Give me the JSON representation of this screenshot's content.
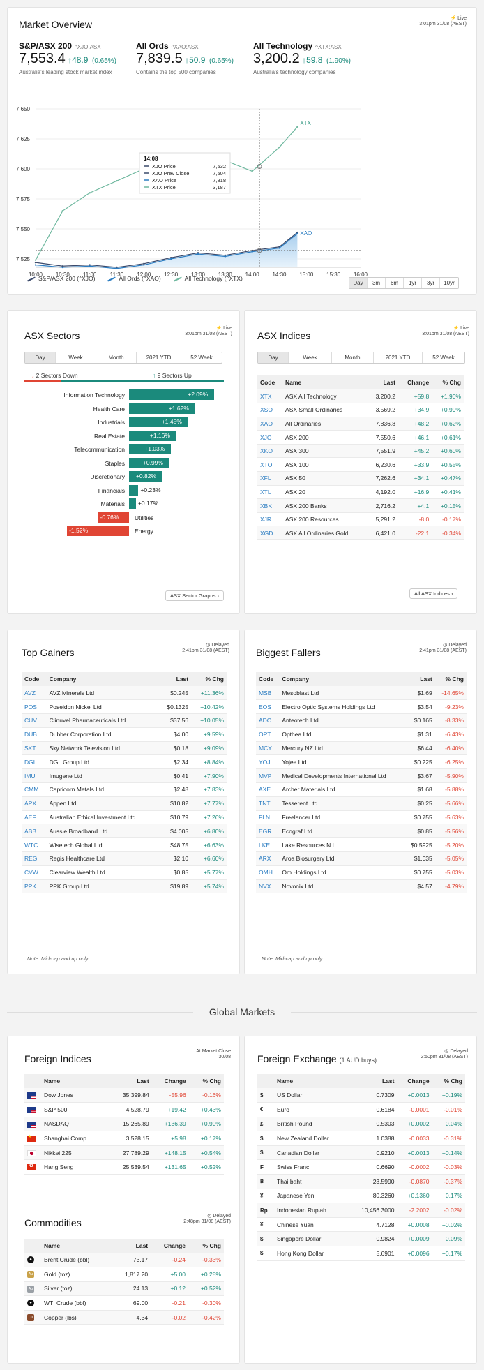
{
  "overview": {
    "title": "Market Overview",
    "live": "Live",
    "time": "3:01pm 31/08 (AEST)",
    "indices": [
      {
        "name": "S&P/ASX 200",
        "code": "^XJO:ASX",
        "value": "7,553.4",
        "change": "48.9",
        "pct": "(0.65%)",
        "desc": "Australia's leading stock market index"
      },
      {
        "name": "All Ords",
        "code": "^XAO:ASX",
        "value": "7,839.5",
        "change": "50.9",
        "pct": "(0.65%)",
        "desc": "Contains the top 500 companies"
      },
      {
        "name": "All Technology",
        "code": "^XTX:ASX",
        "value": "3,200.2",
        "change": "59.8",
        "pct": "(1.90%)",
        "desc": "Australia's technology companies"
      }
    ]
  },
  "chart_data": {
    "type": "line",
    "y_ticks": [
      "7,650",
      "7,625",
      "7,600",
      "7,575",
      "7,550",
      "7,525"
    ],
    "x_ticks": [
      "10:00",
      "10:30",
      "11:00",
      "11:30",
      "12:00",
      "12:30",
      "13:00",
      "13:30",
      "14:00",
      "14:30",
      "15:00",
      "15:30",
      "16:00"
    ],
    "series": [
      {
        "name": "S&P/ASX 200 (^XJO)",
        "color": "#3b4a6b",
        "x": [
          "10:00",
          "10:30",
          "11:00",
          "11:30",
          "12:00",
          "12:30",
          "13:00",
          "13:30",
          "14:00",
          "14:30",
          "14:50"
        ],
        "values": [
          7522,
          7519,
          7520,
          7518,
          7521,
          7526,
          7530,
          7528,
          7532,
          7535,
          7547
        ]
      },
      {
        "name": "All Ords (^XAO)",
        "color": "#2a7cc1",
        "x": [
          "10:00",
          "10:30",
          "11:00",
          "11:30",
          "12:00",
          "12:30",
          "13:00",
          "13:30",
          "14:00",
          "14:30",
          "14:50"
        ],
        "values": [
          7520,
          7518,
          7519,
          7517,
          7520,
          7525,
          7529,
          7527,
          7531,
          7534,
          7546
        ]
      },
      {
        "name": "All Technology (^XTX)",
        "color": "#6fb89f",
        "x": [
          "10:00",
          "10:30",
          "11:00",
          "11:30",
          "12:00",
          "12:30",
          "13:00",
          "13:30",
          "14:00",
          "14:30",
          "14:50"
        ],
        "values": [
          7524,
          7565,
          7580,
          7590,
          7600,
          7606,
          7612,
          7607,
          7598,
          7618,
          7635
        ]
      }
    ],
    "end_labels": [
      "XTX",
      "XAO"
    ],
    "tooltip": {
      "time": "14:08",
      "rows": [
        [
          "XJO Price",
          "7,532"
        ],
        [
          "XJO Prev Close",
          "7,504"
        ],
        [
          "XAO Price",
          "7,818"
        ],
        [
          "XTX Price",
          "3,187"
        ]
      ]
    },
    "ranges": [
      "Day",
      "3m",
      "6m",
      "1yr",
      "3yr",
      "10yr"
    ],
    "active_range": "Day"
  },
  "sectors": {
    "title": "ASX Sectors",
    "live": "Live",
    "time": "3:01pm 31/08 (AEST)",
    "tabs": [
      "Day",
      "Week",
      "Month",
      "2021 YTD",
      "52 Week"
    ],
    "down_label": "Sectors Down",
    "down_count": "2",
    "up_label": "Sectors Up",
    "up_count": "9",
    "items": [
      {
        "name": "Information Technology",
        "value": "+2.09%",
        "pct": 2.09
      },
      {
        "name": "Health Care",
        "value": "+1.62%",
        "pct": 1.62
      },
      {
        "name": "Industrials",
        "value": "+1.45%",
        "pct": 1.45
      },
      {
        "name": "Real Estate",
        "value": "+1.16%",
        "pct": 1.16
      },
      {
        "name": "Telecommunication",
        "value": "+1.03%",
        "pct": 1.03
      },
      {
        "name": "Staples",
        "value": "+0.99%",
        "pct": 0.99
      },
      {
        "name": "Discretionary",
        "value": "+0.82%",
        "pct": 0.82
      },
      {
        "name": "Financials",
        "value": "+0.23%",
        "pct": 0.23
      },
      {
        "name": "Materials",
        "value": "+0.17%",
        "pct": 0.17
      },
      {
        "name": "Utilities",
        "value": "-0.76%",
        "pct": -0.76
      },
      {
        "name": "Energy",
        "value": "-1.52%",
        "pct": -1.52
      }
    ],
    "button": "ASX Sector Graphs"
  },
  "asx_indices": {
    "title": "ASX Indices",
    "live": "Live",
    "time": "3:01pm 31/08 (AEST)",
    "tabs": [
      "Day",
      "Week",
      "Month",
      "2021 YTD",
      "52 Week"
    ],
    "headers": [
      "Code",
      "Name",
      "Last",
      "Change",
      "% Chg"
    ],
    "rows": [
      [
        "XTX",
        "ASX All Technology",
        "3,200.2",
        "+59.8",
        "+1.90%"
      ],
      [
        "XSO",
        "ASX Small Ordinaries",
        "3,569.2",
        "+34.9",
        "+0.99%"
      ],
      [
        "XAO",
        "All Ordinaries",
        "7,836.8",
        "+48.2",
        "+0.62%"
      ],
      [
        "XJO",
        "ASX 200",
        "7,550.6",
        "+46.1",
        "+0.61%"
      ],
      [
        "XKO",
        "ASX 300",
        "7,551.9",
        "+45.2",
        "+0.60%"
      ],
      [
        "XTO",
        "ASX 100",
        "6,230.6",
        "+33.9",
        "+0.55%"
      ],
      [
        "XFL",
        "ASX 50",
        "7,262.6",
        "+34.1",
        "+0.47%"
      ],
      [
        "XTL",
        "ASX 20",
        "4,192.0",
        "+16.9",
        "+0.41%"
      ],
      [
        "XBK",
        "ASX 200 Banks",
        "2,716.2",
        "+4.1",
        "+0.15%"
      ],
      [
        "XJR",
        "ASX 200 Resources",
        "5,291.2",
        "-8.0",
        "-0.17%"
      ],
      [
        "XGD",
        "ASX All Ordinaries Gold",
        "6,421.0",
        "-22.1",
        "-0.34%"
      ]
    ],
    "button": "All ASX Indices"
  },
  "gainers": {
    "title": "Top Gainers",
    "live": "Delayed",
    "time": "2:41pm 31/08 (AEST)",
    "headers": [
      "Code",
      "Company",
      "Last",
      "% Chg"
    ],
    "rows": [
      [
        "AVZ",
        "AVZ Minerals Ltd",
        "$0.245",
        "+11.36%"
      ],
      [
        "POS",
        "Poseidon Nickel Ltd",
        "$0.1325",
        "+10.42%"
      ],
      [
        "CUV",
        "Clinuvel Pharmaceuticals Ltd",
        "$37.56",
        "+10.05%"
      ],
      [
        "DUB",
        "Dubber Corporation Ltd",
        "$4.00",
        "+9.59%"
      ],
      [
        "SKT",
        "Sky Network Television Ltd",
        "$0.18",
        "+9.09%"
      ],
      [
        "DGL",
        "DGL Group Ltd",
        "$2.34",
        "+8.84%"
      ],
      [
        "IMU",
        "Imugene Ltd",
        "$0.41",
        "+7.90%"
      ],
      [
        "CMM",
        "Capricorn Metals Ltd",
        "$2.48",
        "+7.83%"
      ],
      [
        "APX",
        "Appen Ltd",
        "$10.82",
        "+7.77%"
      ],
      [
        "AEF",
        "Australian Ethical Investment Ltd",
        "$10.79",
        "+7.26%"
      ],
      [
        "ABB",
        "Aussie Broadband Ltd",
        "$4.005",
        "+6.80%"
      ],
      [
        "WTC",
        "Wisetech Global Ltd",
        "$48.75",
        "+6.63%"
      ],
      [
        "REG",
        "Regis Healthcare Ltd",
        "$2.10",
        "+6.60%"
      ],
      [
        "CVW",
        "Clearview Wealth Ltd",
        "$0.85",
        "+5.77%"
      ],
      [
        "PPK",
        "PPK Group Ltd",
        "$19.89",
        "+5.74%"
      ]
    ],
    "note": "Note: Mid-cap and up only."
  },
  "fallers": {
    "title": "Biggest Fallers",
    "live": "Delayed",
    "time": "2:41pm 31/08 (AEST)",
    "headers": [
      "Code",
      "Company",
      "Last",
      "% Chg"
    ],
    "rows": [
      [
        "MSB",
        "Mesoblast Ltd",
        "$1.69",
        "-14.65%"
      ],
      [
        "EOS",
        "Electro Optic Systems Holdings Ltd",
        "$3.54",
        "-9.23%"
      ],
      [
        "ADO",
        "Anteotech Ltd",
        "$0.165",
        "-8.33%"
      ],
      [
        "OPT",
        "Opthea Ltd",
        "$1.31",
        "-6.43%"
      ],
      [
        "MCY",
        "Mercury NZ Ltd",
        "$6.44",
        "-6.40%"
      ],
      [
        "YOJ",
        "Yojee Ltd",
        "$0.225",
        "-6.25%"
      ],
      [
        "MVP",
        "Medical Developments International Ltd",
        "$3.67",
        "-5.90%"
      ],
      [
        "AXE",
        "Archer Materials Ltd",
        "$1.68",
        "-5.88%"
      ],
      [
        "TNT",
        "Tesserent Ltd",
        "$0.25",
        "-5.66%"
      ],
      [
        "FLN",
        "Freelancer Ltd",
        "$0.755",
        "-5.63%"
      ],
      [
        "EGR",
        "Ecograf Ltd",
        "$0.85",
        "-5.56%"
      ],
      [
        "LKE",
        "Lake Resources N.L.",
        "$0.5925",
        "-5.20%"
      ],
      [
        "ARX",
        "Aroa Biosurgery Ltd",
        "$1.035",
        "-5.05%"
      ],
      [
        "OMH",
        "Om Holdings Ltd",
        "$0.755",
        "-5.03%"
      ],
      [
        "NVX",
        "Novonix Ltd",
        "$4.57",
        "-4.79%"
      ]
    ],
    "note": "Note: Mid-cap and up only."
  },
  "global": {
    "title": "Global Markets"
  },
  "foreign": {
    "title": "Foreign Indices",
    "live": "At Market Close",
    "time": "30/08",
    "headers": [
      "Name",
      "Last",
      "Change",
      "% Chg"
    ],
    "rows": [
      {
        "flag": "us",
        "cells": [
          "Dow Jones",
          "35,399.84",
          "-55.96",
          "-0.16%"
        ]
      },
      {
        "flag": "us",
        "cells": [
          "S&P 500",
          "4,528.79",
          "+19.42",
          "+0.43%"
        ]
      },
      {
        "flag": "us",
        "cells": [
          "NASDAQ",
          "15,265.89",
          "+136.39",
          "+0.90%"
        ]
      },
      {
        "flag": "cn",
        "cells": [
          "Shanghai Comp.",
          "3,528.15",
          "+5.98",
          "+0.17%"
        ]
      },
      {
        "flag": "jp",
        "cells": [
          "Nikkei 225",
          "27,789.29",
          "+148.15",
          "+0.54%"
        ]
      },
      {
        "flag": "hk",
        "cells": [
          "Hang Seng",
          "25,539.54",
          "+131.65",
          "+0.52%"
        ]
      }
    ]
  },
  "commodities": {
    "title": "Commodities",
    "live": "Delayed",
    "time": "2:48pm 31/08 (AEST)",
    "headers": [
      "Name",
      "Last",
      "Change",
      "% Chg"
    ],
    "rows": [
      {
        "icon": "oil-drop",
        "cells": [
          "Brent Crude (bbl)",
          "73.17",
          "-0.24",
          "-0.33%"
        ]
      },
      {
        "icon": "gold-bar",
        "label": "Au",
        "cells": [
          "Gold (toz)",
          "1,817.20",
          "+5.00",
          "+0.28%"
        ]
      },
      {
        "icon": "silver-bar",
        "label": "Ag",
        "cells": [
          "Silver (toz)",
          "24.13",
          "+0.12",
          "+0.52%"
        ]
      },
      {
        "icon": "oil-drop",
        "cells": [
          "WTI Crude (bbl)",
          "69.00",
          "-0.21",
          "-0.30%"
        ]
      },
      {
        "icon": "copper-bar",
        "label": "Cu",
        "cells": [
          "Copper (lbs)",
          "4.34",
          "-0.02",
          "-0.42%"
        ]
      }
    ]
  },
  "fx": {
    "title": "Foreign Exchange",
    "subtitle": "(1 AUD buys)",
    "live": "Delayed",
    "time": "2:50pm 31/08 (AEST)",
    "headers": [
      "Name",
      "Last",
      "Change",
      "% Chg"
    ],
    "rows": [
      [
        "$",
        "US Dollar",
        "0.7309",
        "+0.0013",
        "+0.19%"
      ],
      [
        "€",
        "Euro",
        "0.6184",
        "-0.0001",
        "-0.01%"
      ],
      [
        "£",
        "British Pound",
        "0.5303",
        "+0.0002",
        "+0.04%"
      ],
      [
        "$",
        "New Zealand Dollar",
        "1.0388",
        "-0.0033",
        "-0.31%"
      ],
      [
        "$",
        "Canadian Dollar",
        "0.9210",
        "+0.0013",
        "+0.14%"
      ],
      [
        "F",
        "Swiss Franc",
        "0.6690",
        "-0.0002",
        "-0.03%"
      ],
      [
        "฿",
        "Thai baht",
        "23.5990",
        "-0.0870",
        "-0.37%"
      ],
      [
        "¥",
        "Japanese Yen",
        "80.3260",
        "+0.1360",
        "+0.17%"
      ],
      [
        "Rp",
        "Indonesian Rupiah",
        "10,456.3000",
        "-2.2002",
        "-0.02%"
      ],
      [
        "¥",
        "Chinese Yuan",
        "4.7128",
        "+0.0008",
        "+0.02%"
      ],
      [
        "$",
        "Singapore Dollar",
        "0.9824",
        "+0.0009",
        "+0.09%"
      ],
      [
        "$",
        "Hong Kong Dollar",
        "5.6901",
        "+0.0096",
        "+0.17%"
      ]
    ]
  }
}
